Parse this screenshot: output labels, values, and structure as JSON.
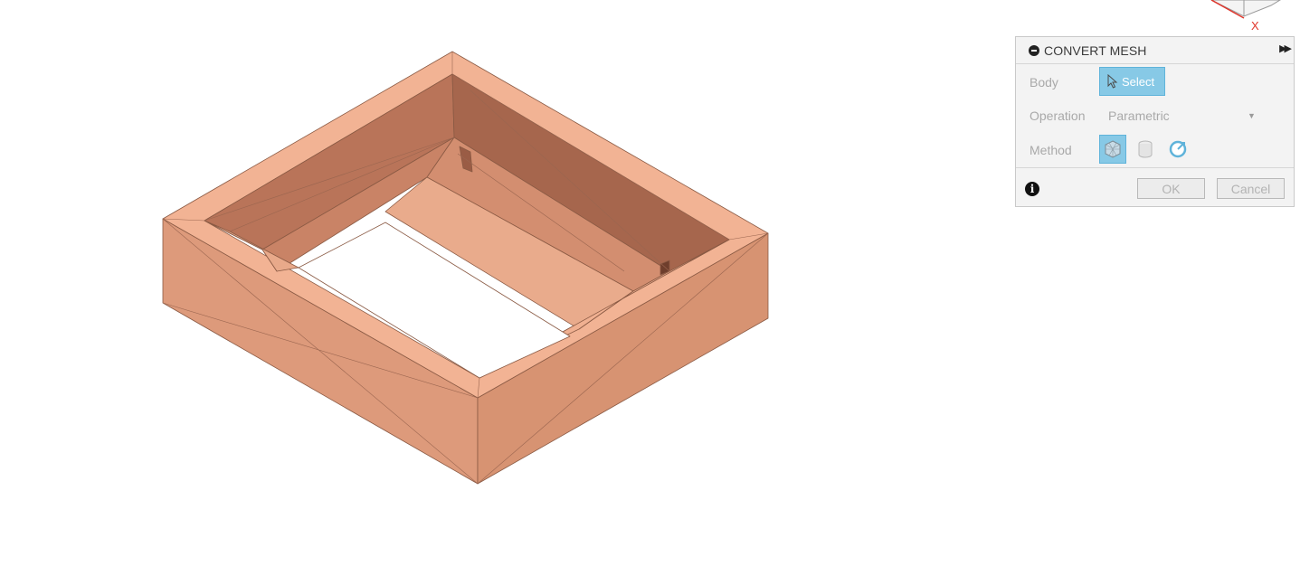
{
  "panel": {
    "title": "CONVERT MESH",
    "collapse_icon": "minus-circle-icon",
    "expand_icon": "double-chevron-right-icon",
    "body": {
      "label": "Body",
      "button_label": "Select",
      "icon": "cursor-arrow-icon"
    },
    "operation": {
      "label": "Operation",
      "value": "Parametric",
      "dropdown_icon": "triangle-down-icon"
    },
    "method": {
      "label": "Method",
      "options": [
        {
          "icon": "faceted-cube-icon",
          "selected": true
        },
        {
          "icon": "cylinder-icon",
          "selected": false
        },
        {
          "icon": "prismatic-refresh-icon",
          "selected": false
        }
      ]
    },
    "info_icon": "info-icon",
    "ok_label": "OK",
    "cancel_label": "Cancel"
  },
  "viewcube": {
    "axis_label": "X"
  },
  "colors": {
    "accent": "#87c9e6",
    "body_fill": "#e5a483",
    "axis_red": "#e0352b"
  }
}
